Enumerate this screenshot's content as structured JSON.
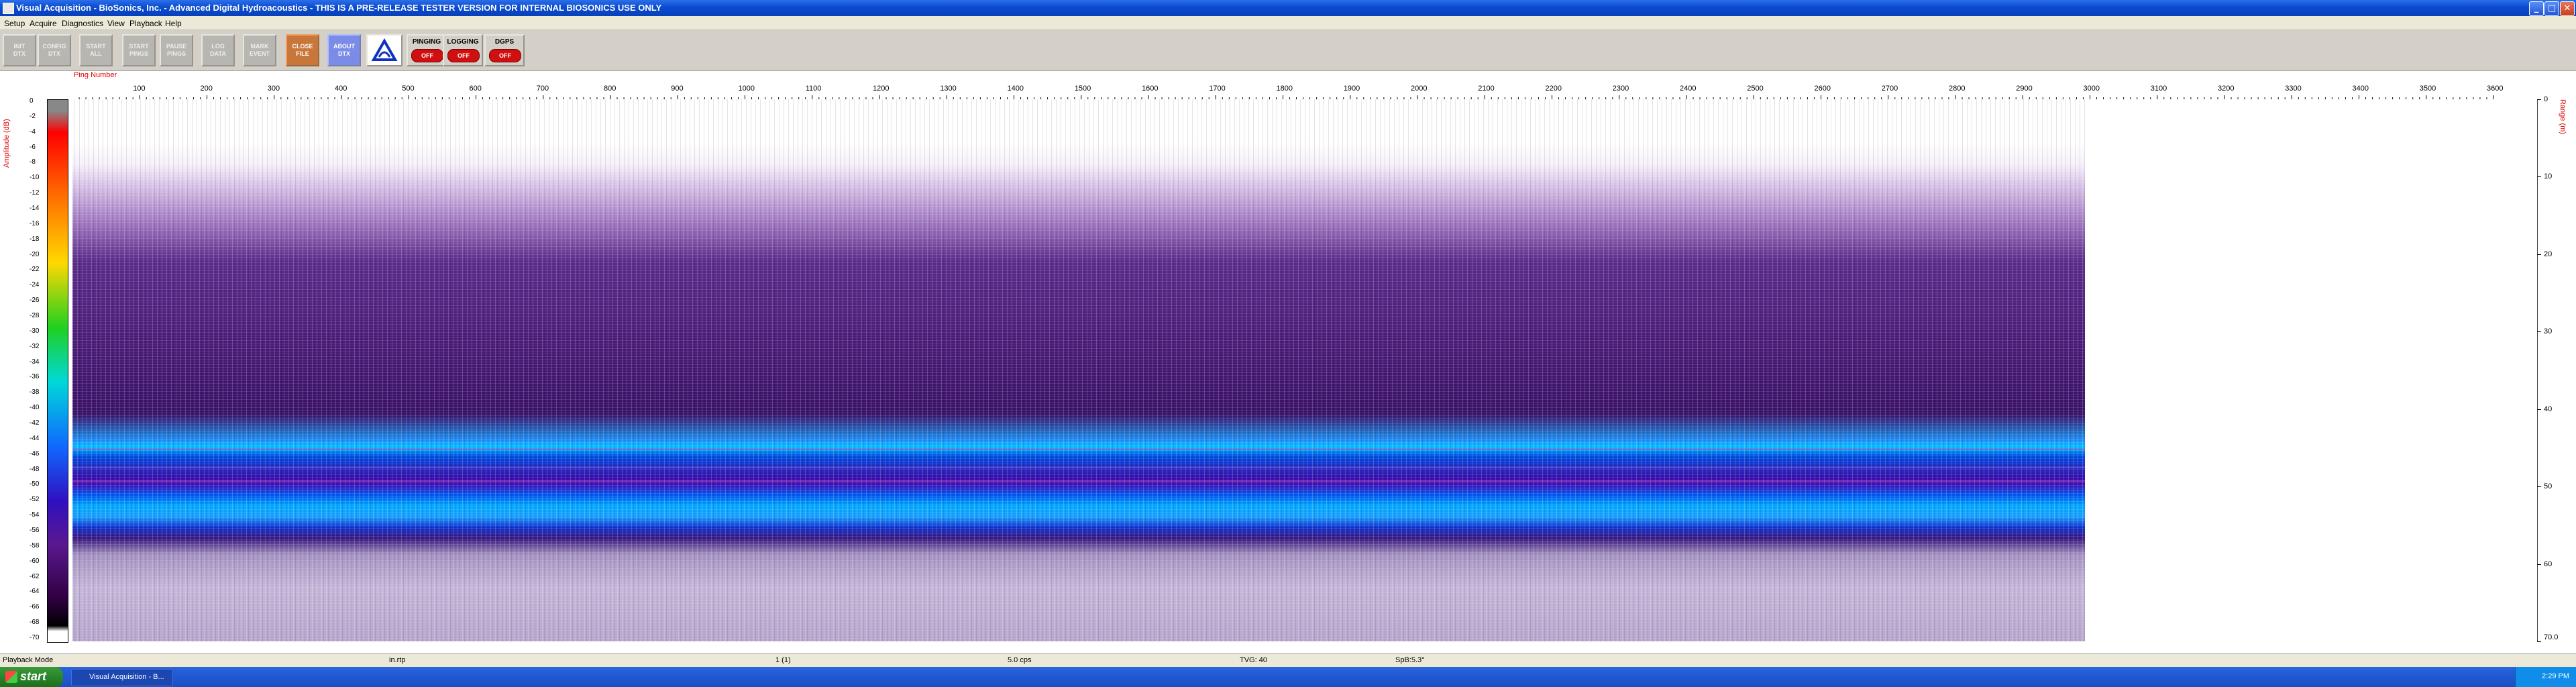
{
  "window": {
    "title": "Visual Acquisition  -  BioSonics, Inc.  -  Advanced Digital Hydroacoustics  -  THIS IS A PRE-RELEASE TESTER VERSION FOR INTERNAL BIOSONICS USE ONLY",
    "min_glyph": "_",
    "max_glyph": "□",
    "close_glyph": "✕"
  },
  "menu": [
    "Setup",
    "Acquire",
    "Diagnostics",
    "View",
    "Playback",
    "Help"
  ],
  "toolbar": {
    "buttons": [
      {
        "label": "INIT\nDTX",
        "state": "disabled"
      },
      {
        "label": "CONFIG\nDTX",
        "state": "disabled"
      },
      {
        "label": "START\nALL",
        "state": "disabled"
      },
      {
        "label": "START\nPINGS",
        "state": "disabled"
      },
      {
        "label": "PAUSE\nPINGS",
        "state": "disabled"
      },
      {
        "label": "LOG\nDATA",
        "state": "disabled"
      },
      {
        "label": "MARK\nEVENT",
        "state": "disabled"
      },
      {
        "label": "CLOSE\nFILE",
        "state": "active-orange"
      },
      {
        "label": "ABOUT\nDTX",
        "state": "active-blue"
      }
    ],
    "indicators": [
      {
        "label": "PINGING",
        "value": "OFF"
      },
      {
        "label": "LOGGING",
        "value": "OFF"
      },
      {
        "label": "DGPS",
        "value": "OFF"
      }
    ]
  },
  "echogram": {
    "x_axis_title": "Ping Number",
    "x_ticks": [
      "100",
      "200",
      "300",
      "400",
      "500",
      "600",
      "700",
      "800",
      "900",
      "1000",
      "1100",
      "1200",
      "1300",
      "1400",
      "1500",
      "1600",
      "1700",
      "1800",
      "1900",
      "2000",
      "2100",
      "2200",
      "2300",
      "2400",
      "2500",
      "2600",
      "2700",
      "2800",
      "2900",
      "3000",
      "3100",
      "3200",
      "3300",
      "3400",
      "3500",
      "3600"
    ],
    "amplitude_title": "Amplitude (dB)",
    "amplitude_ticks": [
      "0",
      "-2",
      "-4",
      "-6",
      "-8",
      "-10",
      "-12",
      "-14",
      "-16",
      "-18",
      "-20",
      "-22",
      "-24",
      "-26",
      "-28",
      "-30",
      "-32",
      "-34",
      "-36",
      "-38",
      "-40",
      "-42",
      "-44",
      "-46",
      "-48",
      "-50",
      "-52",
      "-54",
      "-56",
      "-58",
      "-60",
      "-62",
      "-64",
      "-66",
      "-68",
      "-70"
    ],
    "range_title": "Range (m)",
    "range_ticks": [
      "0",
      "10",
      "20",
      "30",
      "40",
      "50",
      "60",
      "70.0"
    ]
  },
  "status": {
    "mode": "Playback Mode",
    "field2": "in.rtp",
    "field3": "1 (1)",
    "field4": "5.0 cps",
    "field5": "TVG: 40",
    "field6": "SpB:5.3°"
  },
  "taskbar": {
    "start_label": "start",
    "task_label": "Visual Acquisition - B...",
    "clock": "2:29 PM"
  }
}
